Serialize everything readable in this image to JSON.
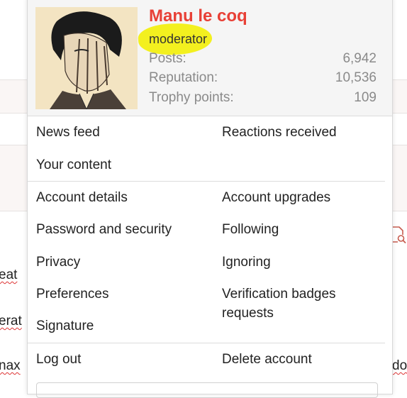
{
  "profile": {
    "username": "Manu le coq",
    "role": "moderator",
    "stats": [
      {
        "label": "Posts:",
        "value": "6,942"
      },
      {
        "label": "Reputation:",
        "value": "10,536"
      },
      {
        "label": "Trophy points:",
        "value": "109"
      }
    ]
  },
  "menu": {
    "news_feed": "News feed",
    "reactions_received": "Reactions received",
    "your_content": "Your content",
    "account_details": "Account details",
    "account_upgrades": "Account upgrades",
    "password_security": "Password and security",
    "following": "Following",
    "privacy": "Privacy",
    "ignoring": "Ignoring",
    "preferences": "Preferences",
    "verification_badges": "Verification badges requests",
    "signature": "Signature",
    "log_out": "Log out",
    "delete_account": "Delete account"
  },
  "background": {
    "frag_1": "eat",
    "frag_2": "erat",
    "frag_3": "nax",
    "frag_4": "do"
  },
  "colors": {
    "username": "#e84036",
    "highlight": "#f3f01f"
  },
  "icons": {
    "search_document": "document-search-icon"
  }
}
